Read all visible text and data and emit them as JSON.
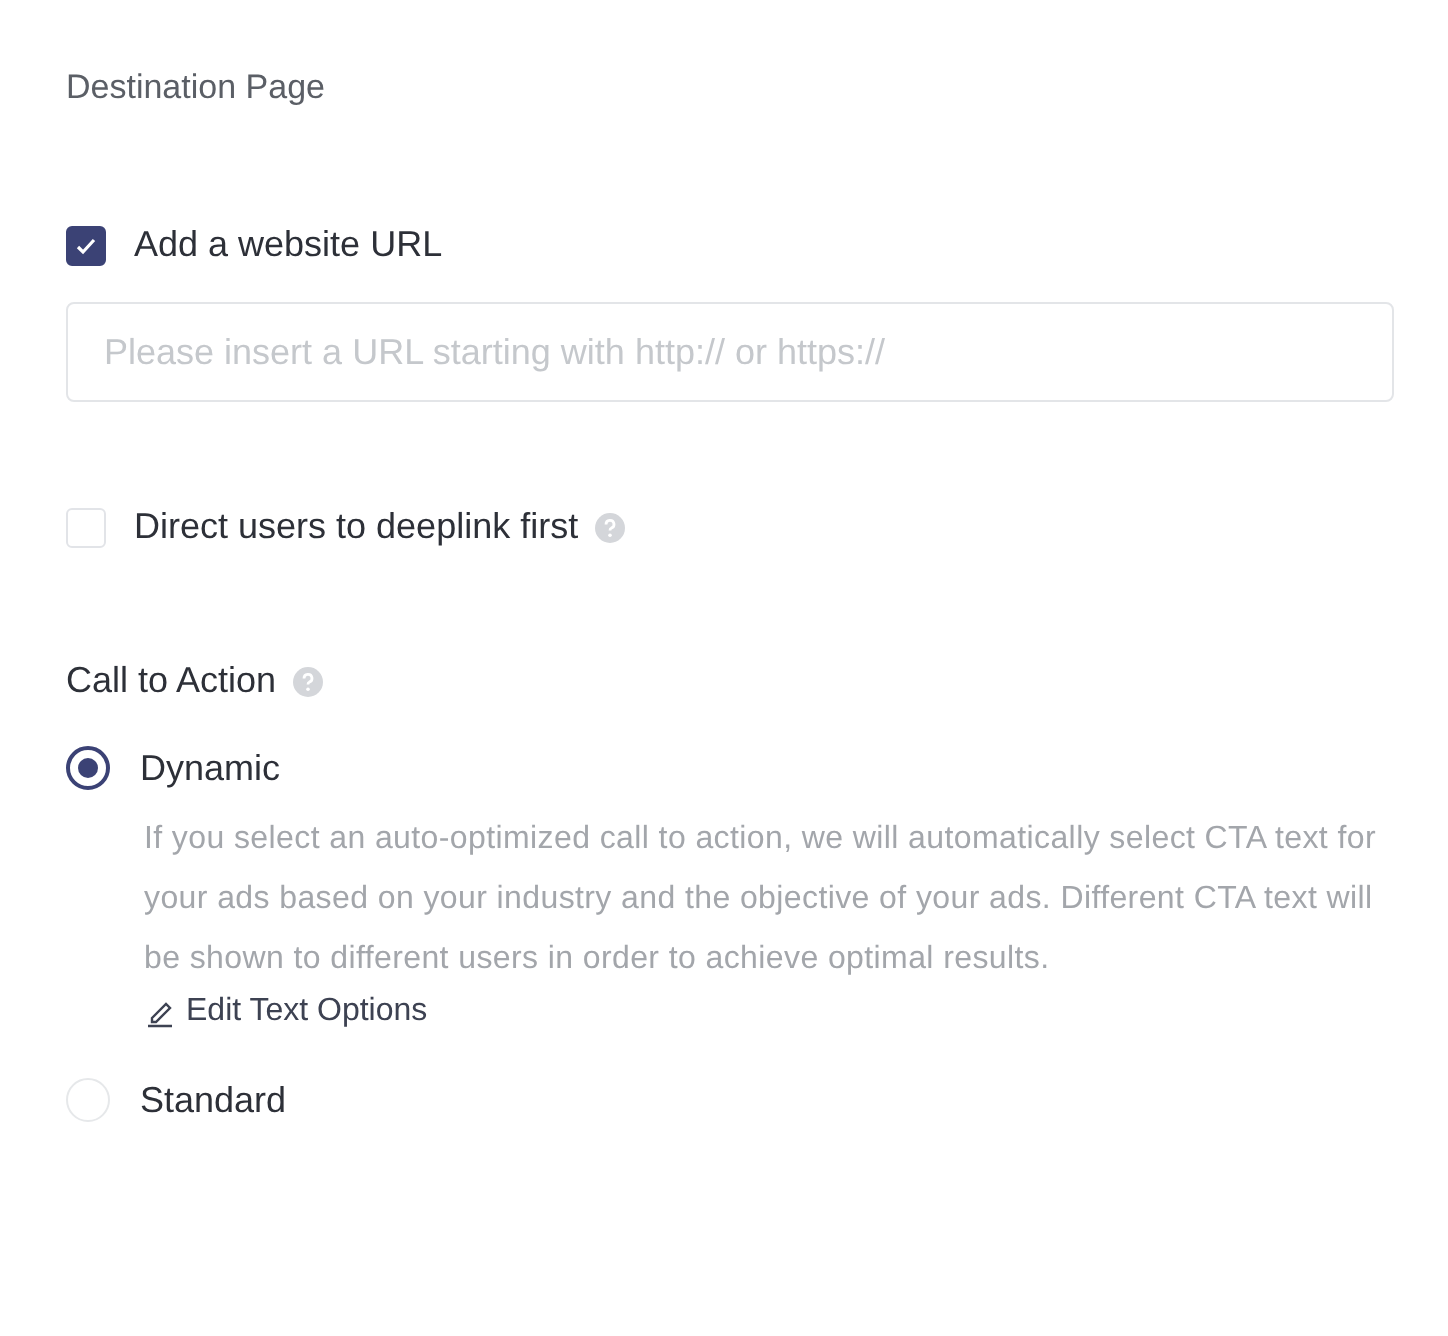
{
  "section_title": "Destination Page",
  "website_url": {
    "label": "Add a website URL",
    "checked": true
  },
  "url_field": {
    "placeholder": "Please insert a URL starting with http:// or https://"
  },
  "deeplink": {
    "label": "Direct users to deeplink first",
    "checked": false
  },
  "call_to_action": {
    "title": "Call to Action",
    "options": [
      {
        "label": "Dynamic",
        "selected": true,
        "description": "If you select an auto-optimized call to action, we will automatically select CTA text for your ads based on your industry and the objective of your ads. Different CTA text will be shown to different users in order to achieve optimal results.",
        "link": "Edit Text Options"
      },
      {
        "label": "Standard",
        "selected": false
      }
    ]
  }
}
